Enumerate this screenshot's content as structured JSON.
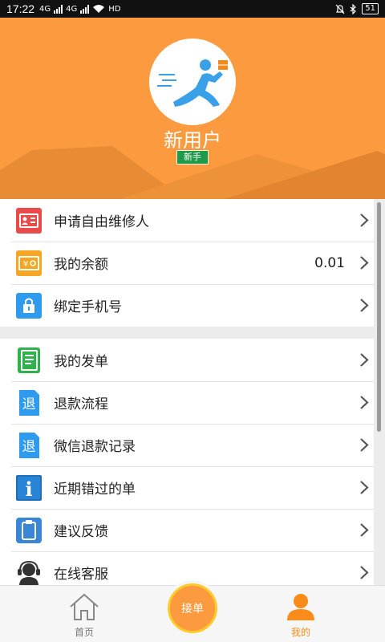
{
  "status_bar": {
    "time": "17:22",
    "net1": "4G",
    "net2": "4G",
    "hd": "HD",
    "battery": "51"
  },
  "profile": {
    "name": "新用户",
    "badge": "新手"
  },
  "menu_group1": [
    {
      "label": "申请自由维修人",
      "icon": "id-card-icon",
      "color": "#e94b4b"
    },
    {
      "label": "我的余额",
      "value": "0.01",
      "icon": "money-icon",
      "color": "#f6a623"
    },
    {
      "label": "绑定手机号",
      "icon": "lock-icon",
      "color": "#2e9bef"
    }
  ],
  "menu_group2": [
    {
      "label": "我的发单",
      "icon": "notebook-icon",
      "color": "#2fb24b"
    },
    {
      "label": "退款流程",
      "icon": "refund-icon",
      "color": "#2e9bef",
      "glyph": "退"
    },
    {
      "label": "微信退款记录",
      "icon": "refund-record-icon",
      "color": "#2e9bef",
      "glyph": "退"
    },
    {
      "label": "近期错过的单",
      "icon": "info-icon",
      "color": "#1f6fbf",
      "glyph": "i"
    },
    {
      "label": "建议反馈",
      "icon": "clipboard-icon",
      "color": "#3a86d6"
    },
    {
      "label": "在线客服",
      "icon": "headset-icon",
      "color": "#333333"
    }
  ],
  "bottom_nav": {
    "home": "首页",
    "grab": "接单",
    "mine": "我的"
  },
  "colors": {
    "accent": "#fb9a3e",
    "badge": "#1f9a4a",
    "active_tab": "#fb8c1a"
  }
}
